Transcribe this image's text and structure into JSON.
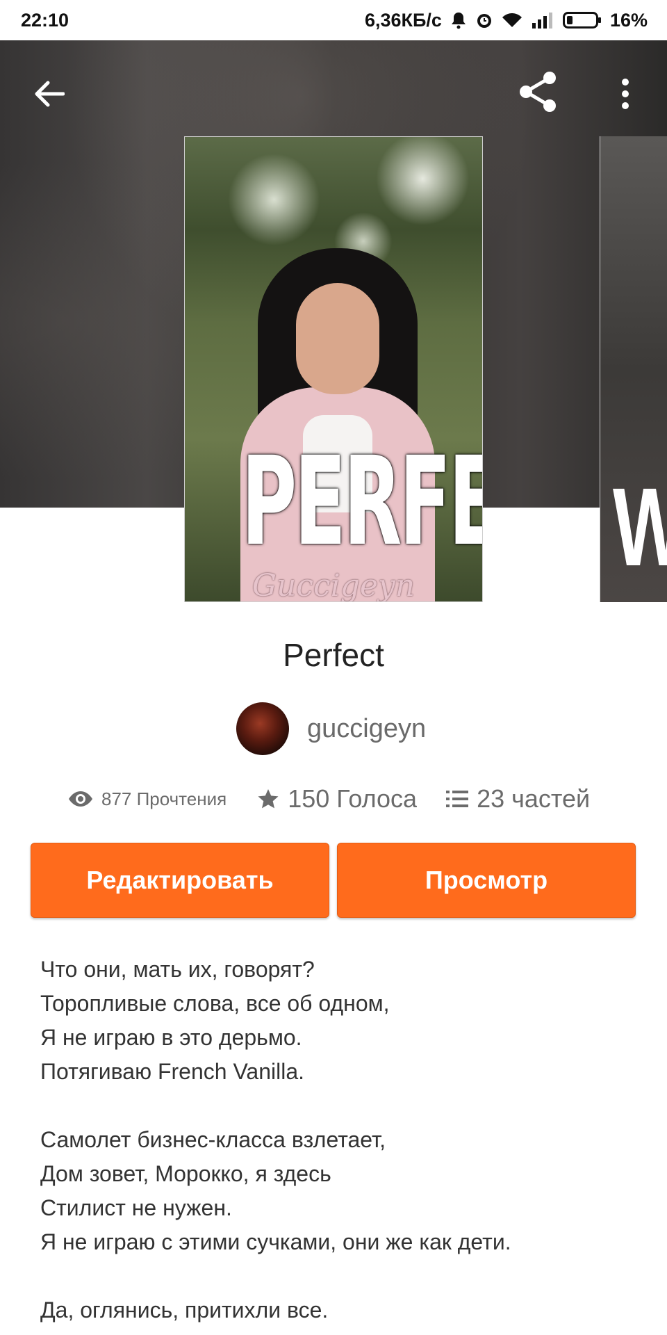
{
  "status_bar": {
    "time": "22:10",
    "speed": "6,36КБ/с",
    "battery": "16%",
    "icons": [
      "bell-icon",
      "alarm-icon",
      "wifi-icon",
      "signal-icon",
      "battery-icon"
    ]
  },
  "toolbar": {
    "back_icon": "arrow-left-icon",
    "share_icon": "share-icon",
    "more_icon": "more-vert-icon"
  },
  "cover": {
    "title_text": "PERFECT",
    "signature": "Guccigeyn",
    "next_cover_letter": "W"
  },
  "story": {
    "title": "Perfect",
    "author": "guccigeyn"
  },
  "stats": {
    "reads": "877 Прочтения",
    "votes": "150 Голоса",
    "parts": "23 частей"
  },
  "actions": {
    "edit_label": "Редактировать",
    "view_label": "Просмотр"
  },
  "description": [
    "Что они, мать их, говорят?",
    "Торопливые слова, все об одном,",
    "Я не играю в это дерьмо.",
    "Потягиваю French Vanilla.",
    "",
    "Самолет бизнес-класса взлетает,",
    "Дом зовет, Морокко, я здесь",
    "Стилист не нужен.",
    "Я не играю с этими сучками, они же как дети.",
    "",
    "Да, оглянись, притихли все."
  ],
  "colors": {
    "accent": "#ff6b1c",
    "text_secondary": "#6b6b6b"
  }
}
